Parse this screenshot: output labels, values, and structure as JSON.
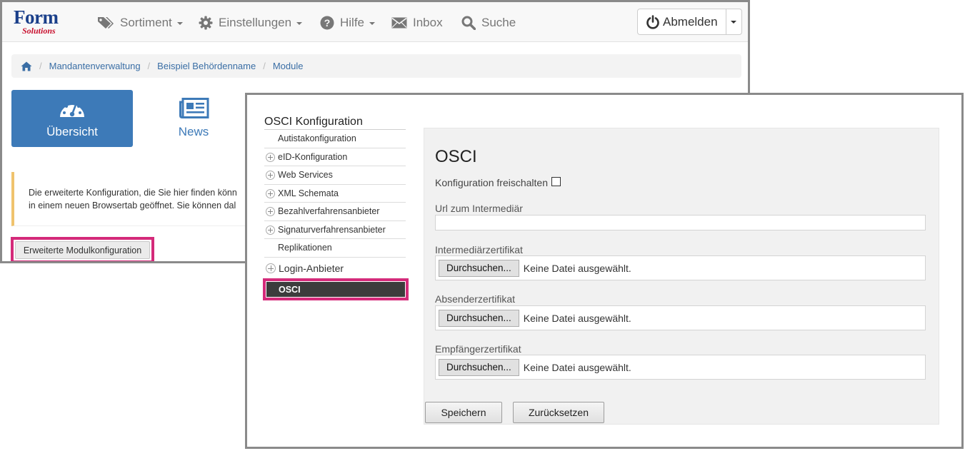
{
  "brand": {
    "logo_word": "Form",
    "logo_sub": "Solutions"
  },
  "nav": {
    "sortiment": "Sortiment",
    "einstellungen": "Einstellungen",
    "hilfe": "Hilfe",
    "inbox": "Inbox",
    "suche": "Suche",
    "logout": "Abmelden"
  },
  "breadcrumb": [
    "Mandantenverwaltung",
    "Beispiel Behördenname",
    "Module"
  ],
  "tiles": {
    "overview": "Übersicht",
    "news": "News"
  },
  "alert": {
    "line1": "Die erweiterte Konfiguration, die Sie hier finden könn",
    "line2": "in einem neuen Browsertab geöffnet. Sie können dal"
  },
  "extended_config_button": "Erweiterte Modulkonfiguration",
  "sidebar": {
    "title": "OSCI Konfiguration",
    "items": [
      {
        "label": "Autistakonfiguration",
        "expandable": false
      },
      {
        "label": "eID-Konfiguration",
        "expandable": true
      },
      {
        "label": "Web Services",
        "expandable": true
      },
      {
        "label": "XML Schemata",
        "expandable": true
      },
      {
        "label": "Bezahlverfahrensanbieter",
        "expandable": true
      },
      {
        "label": "Signaturverfahrensanbieter",
        "expandable": true
      },
      {
        "label": "Replikationen",
        "expandable": false
      }
    ],
    "login": "Login-Anbieter",
    "active": "OSCI"
  },
  "form": {
    "title": "OSCI",
    "enable_label": "Konfiguration freischalten",
    "url_label": "Url zum Intermediär",
    "url_value": "",
    "intermediary_label": "Intermediärzertifikat",
    "sender_label": "Absenderzertifikat",
    "recipient_label": "Empfängerzertifikat",
    "browse": "Durchsuchen...",
    "no_file": "Keine Datei ausgewählt.",
    "save": "Speichern",
    "reset": "Zurücksetzen"
  },
  "colors": {
    "primary": "#3d7ab8",
    "highlight": "#d42a7a",
    "active_item": "#3c3c3c"
  }
}
